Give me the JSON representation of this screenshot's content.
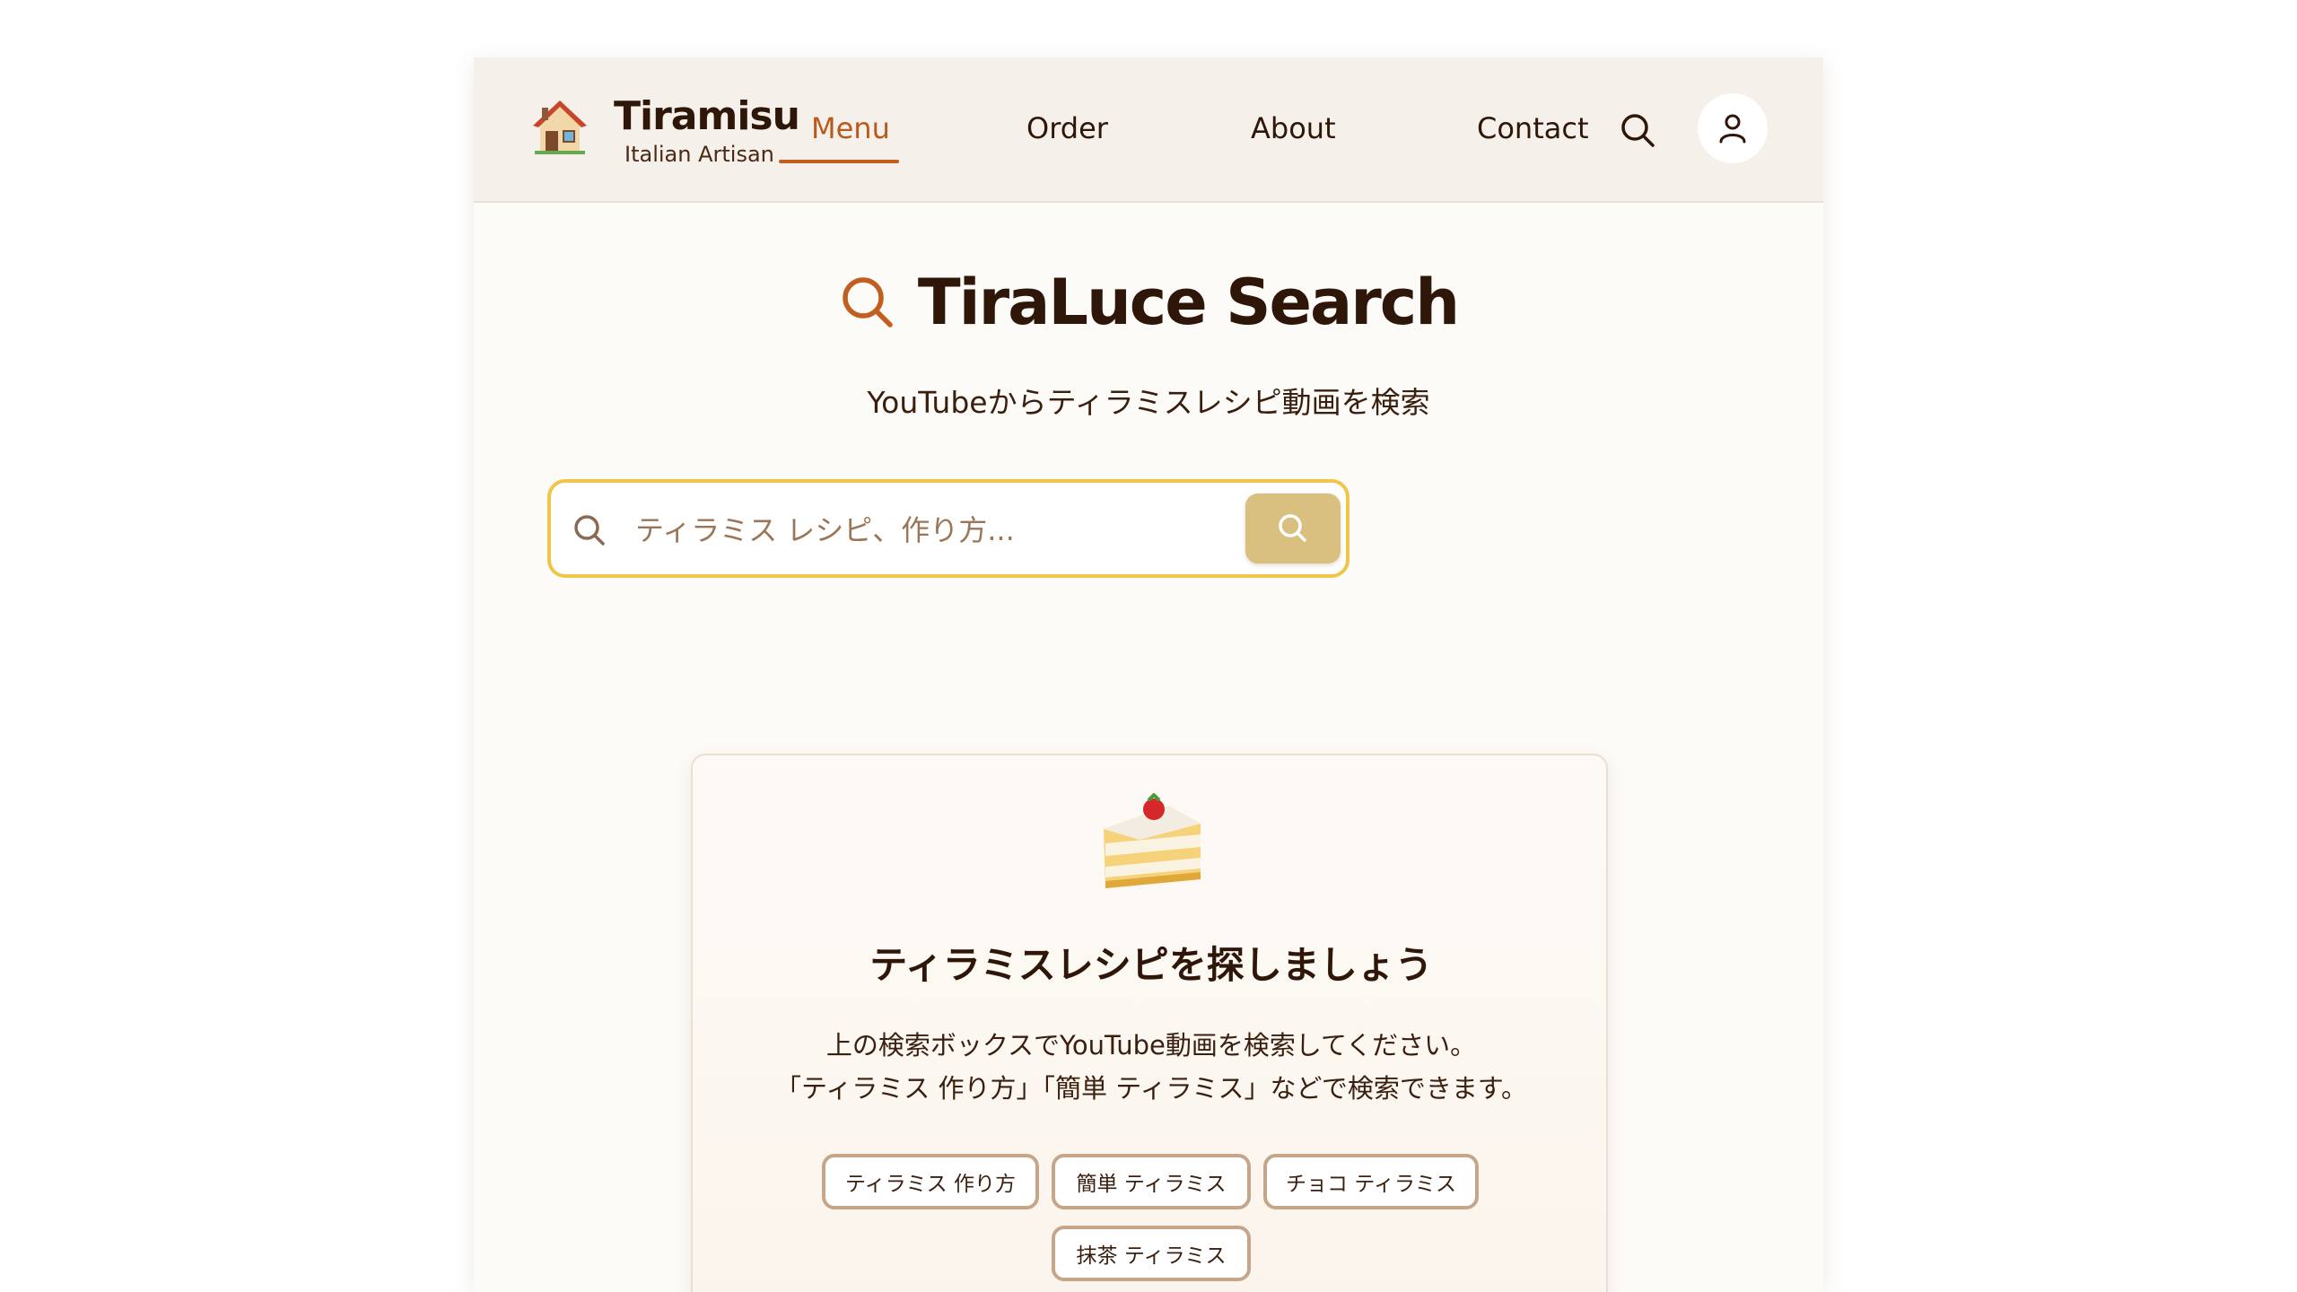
{
  "header": {
    "brand_title": "Tiramisu",
    "brand_subtitle": "Italian Artisan",
    "nav": [
      {
        "label": "Menu",
        "active": true
      },
      {
        "label": "Order",
        "active": false
      },
      {
        "label": "About",
        "active": false
      },
      {
        "label": "Contact",
        "active": false
      }
    ],
    "icons": [
      "house-icon",
      "search-icon",
      "user-icon"
    ]
  },
  "hero": {
    "title": "TiraLuce Search",
    "subtitle": "YouTubeからティラミスレシピ動画を検索"
  },
  "search": {
    "placeholder": "ティラミス レシピ、作り方...",
    "value": ""
  },
  "empty_state": {
    "icon": "cake-icon",
    "title": "ティラミスレシピを探しましょう",
    "line1": "上の検索ボックスでYouTube動画を検索してください。",
    "line2": "「ティラミス 作り方」「簡単 ティラミス」などで検索できます。",
    "suggestions": [
      "ティラミス 作り方",
      "簡単 ティラミス",
      "チョコ ティラミス",
      "抹茶 ティラミス"
    ]
  },
  "colors": {
    "accent": "#c25e1f",
    "search_border": "#f0c64a",
    "search_button": "#d9c080",
    "chip_border": "#c5a68a",
    "header_bg": "#f5f0e9"
  }
}
